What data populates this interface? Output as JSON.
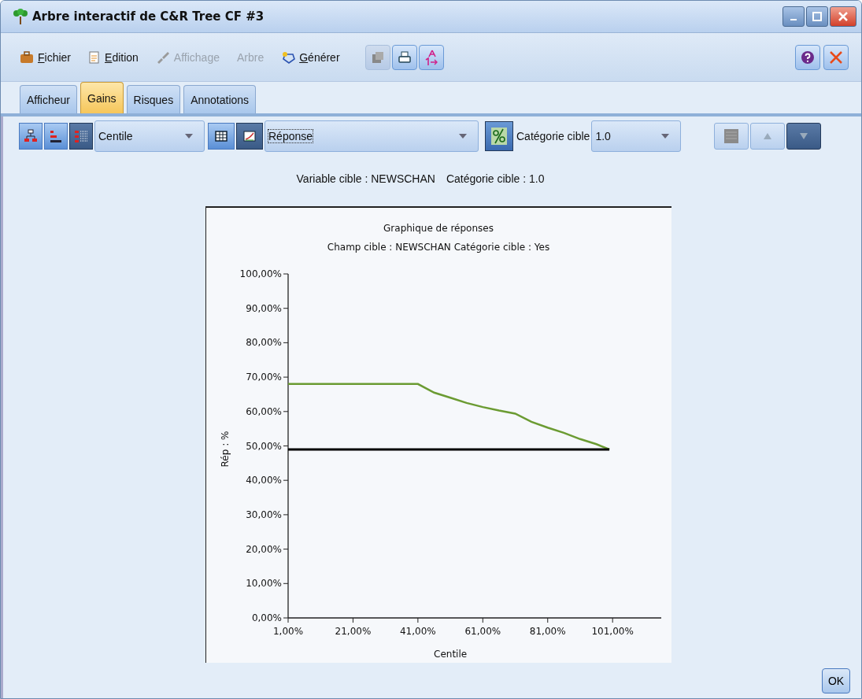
{
  "window": {
    "title": "Arbre interactif de C&R Tree CF #3"
  },
  "menu": [
    {
      "label": "Fichier",
      "underlined": true,
      "disabled": false
    },
    {
      "label": "Edition",
      "underlined": true,
      "disabled": false
    },
    {
      "label": "Affichage",
      "underlined": false,
      "disabled": true
    },
    {
      "label": "Arbre",
      "underlined": false,
      "disabled": true
    },
    {
      "label": "Générer",
      "underlined": true,
      "disabled": false
    }
  ],
  "toolbar_buttons": [
    {
      "disabled": true
    },
    {
      "disabled": false
    },
    {
      "disabled": false
    }
  ],
  "tabs": [
    {
      "label": "Afficheur",
      "selected": false
    },
    {
      "label": "Gains",
      "selected": true
    },
    {
      "label": "Risques",
      "selected": false
    },
    {
      "label": "Annotations",
      "selected": false
    }
  ],
  "view_buttons": [
    {
      "selected": false
    },
    {
      "selected": false
    },
    {
      "selected": true
    }
  ],
  "centile_dropdown": {
    "value": "Centile"
  },
  "display_buttons": [
    {
      "selected": false
    },
    {
      "selected": true
    }
  ],
  "measure_dropdown": {
    "value": "Réponse"
  },
  "profit_button": {
    "selected": true
  },
  "target_label": "Catégorie cible",
  "target_dropdown": {
    "value": "1.0"
  },
  "nav_buttons": [
    {
      "disabled": true
    },
    {
      "disabled": true
    },
    {
      "disabled": false
    }
  ],
  "header": [
    "Variable cible : NEWSCHAN",
    "Catégorie cible : 1.0"
  ],
  "chart": {
    "subtitle": "Champ cible : NEWSCHAN  Catégorie cible : Yes",
    "chart_data": {
      "type": "line",
      "title": "Graphique de réponses",
      "xlabel": "Centile",
      "ylabel": "Rép : %",
      "x": [
        1,
        11,
        21,
        31,
        41,
        46,
        51,
        56,
        61,
        66,
        71,
        76,
        81,
        86,
        91,
        96,
        100
      ],
      "series": [
        {
          "color": "#6b9b32",
          "values": [
            68,
            68,
            68,
            68,
            68,
            65.5,
            64,
            62.5,
            61.3,
            60.3,
            59.4,
            57,
            55.3,
            53.8,
            52,
            50.5,
            49
          ]
        },
        {
          "color": "#000000",
          "values": [
            49,
            49,
            49,
            49,
            49,
            49,
            49,
            49,
            49,
            49,
            49,
            49,
            49,
            49,
            49,
            49,
            49
          ]
        }
      ],
      "xlim": [
        1,
        116
      ],
      "ylim": [
        0,
        100
      ],
      "xticks": [
        {
          "value": 1,
          "label": "1,00%"
        },
        {
          "value": 21,
          "label": "21,00%"
        },
        {
          "value": 41,
          "label": "41,00%"
        },
        {
          "value": 61,
          "label": "61,00%"
        },
        {
          "value": 81,
          "label": "81,00%"
        },
        {
          "value": 101,
          "label": "101,00%"
        }
      ],
      "yticks": [
        {
          "value": 0,
          "label": "0,00%"
        },
        {
          "value": 10,
          "label": "10,00%"
        },
        {
          "value": 20,
          "label": "20,00%"
        },
        {
          "value": 30,
          "label": "30,00%"
        },
        {
          "value": 40,
          "label": "40,00%"
        },
        {
          "value": 50,
          "label": "50,00%"
        },
        {
          "value": 60,
          "label": "60,00%"
        },
        {
          "value": 70,
          "label": "70,00%"
        },
        {
          "value": 80,
          "label": "80,00%"
        },
        {
          "value": 90,
          "label": "90,00%"
        },
        {
          "value": 100,
          "label": "100,00%"
        }
      ]
    }
  },
  "ok_button": "OK"
}
